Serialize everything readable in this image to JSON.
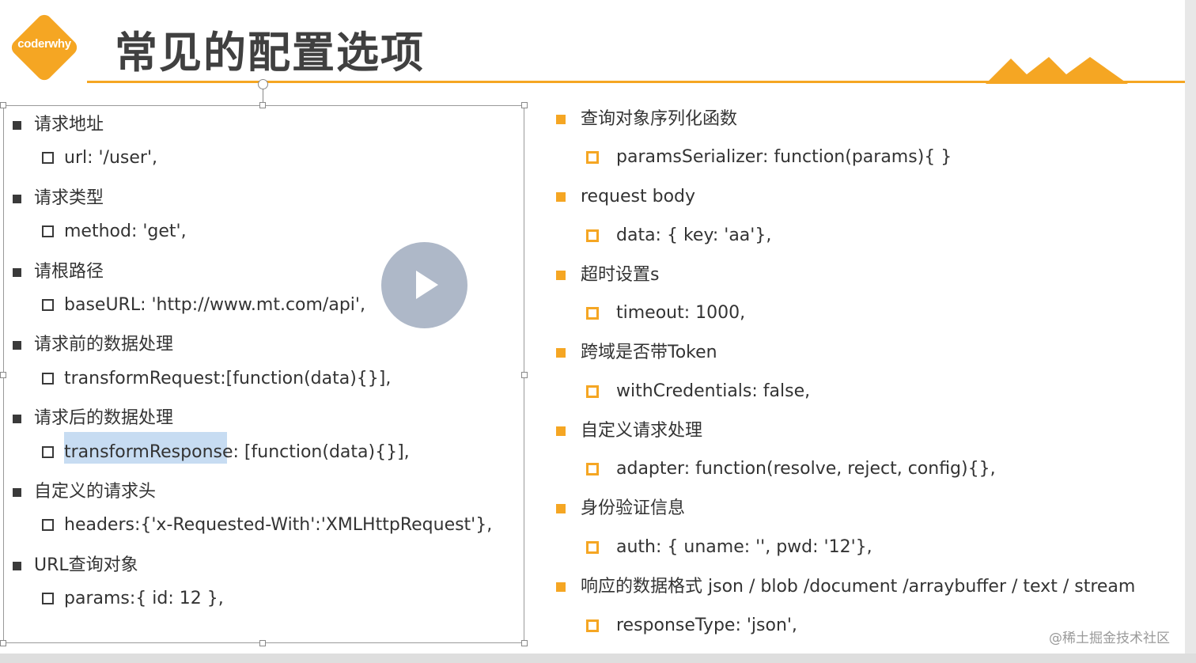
{
  "header": {
    "logo_text": "coderwhy",
    "title": "常见的配置选项",
    "accent_color": "#f5a623"
  },
  "left_items": [
    {
      "level": 1,
      "text": "请求地址"
    },
    {
      "level": 2,
      "text": "url: '/user',"
    },
    {
      "level": 1,
      "text": "请求类型"
    },
    {
      "level": 2,
      "text": "method: 'get',"
    },
    {
      "level": 1,
      "text": "请根路径"
    },
    {
      "level": 2,
      "text": "baseURL: 'http://www.mt.com/api',"
    },
    {
      "level": 1,
      "text": "请求前的数据处理"
    },
    {
      "level": 2,
      "text": "transformRequest:[function(data){}],"
    },
    {
      "level": 1,
      "text": "请求后的数据处理"
    },
    {
      "level": 2,
      "text": "transformResponse: [function(data){}],",
      "highlight": "transformResponse"
    },
    {
      "level": 1,
      "text": "自定义的请求头"
    },
    {
      "level": 2,
      "text": "headers:{'x-Requested-With':'XMLHttpRequest'},"
    },
    {
      "level": 1,
      "text": "URL查询对象"
    },
    {
      "level": 2,
      "text": "params:{ id: 12 },"
    }
  ],
  "right_items": [
    {
      "level": 1,
      "text": "查询对象序列化函数"
    },
    {
      "level": 2,
      "text": "paramsSerializer: function(params){ }"
    },
    {
      "level": 1,
      "text": "request body"
    },
    {
      "level": 2,
      "text": "data: { key: 'aa'},"
    },
    {
      "level": 1,
      "text": "超时设置s"
    },
    {
      "level": 2,
      "text": "timeout: 1000,"
    },
    {
      "level": 1,
      "text": "跨域是否带Token"
    },
    {
      "level": 2,
      "text": "withCredentials: false,"
    },
    {
      "level": 1,
      "text": "自定义请求处理"
    },
    {
      "level": 2,
      "text": "adapter: function(resolve, reject, config){},"
    },
    {
      "level": 1,
      "text": "身份验证信息"
    },
    {
      "level": 2,
      "text": "auth: { uname: '', pwd: '12'},"
    },
    {
      "level": 1,
      "text": "响应的数据格式 json / blob /document /arraybuffer / text / stream"
    },
    {
      "level": 2,
      "text": "responseType: 'json',"
    }
  ],
  "video": {
    "play_icon": "play-icon"
  },
  "watermark": "@稀土掘金技术社区"
}
